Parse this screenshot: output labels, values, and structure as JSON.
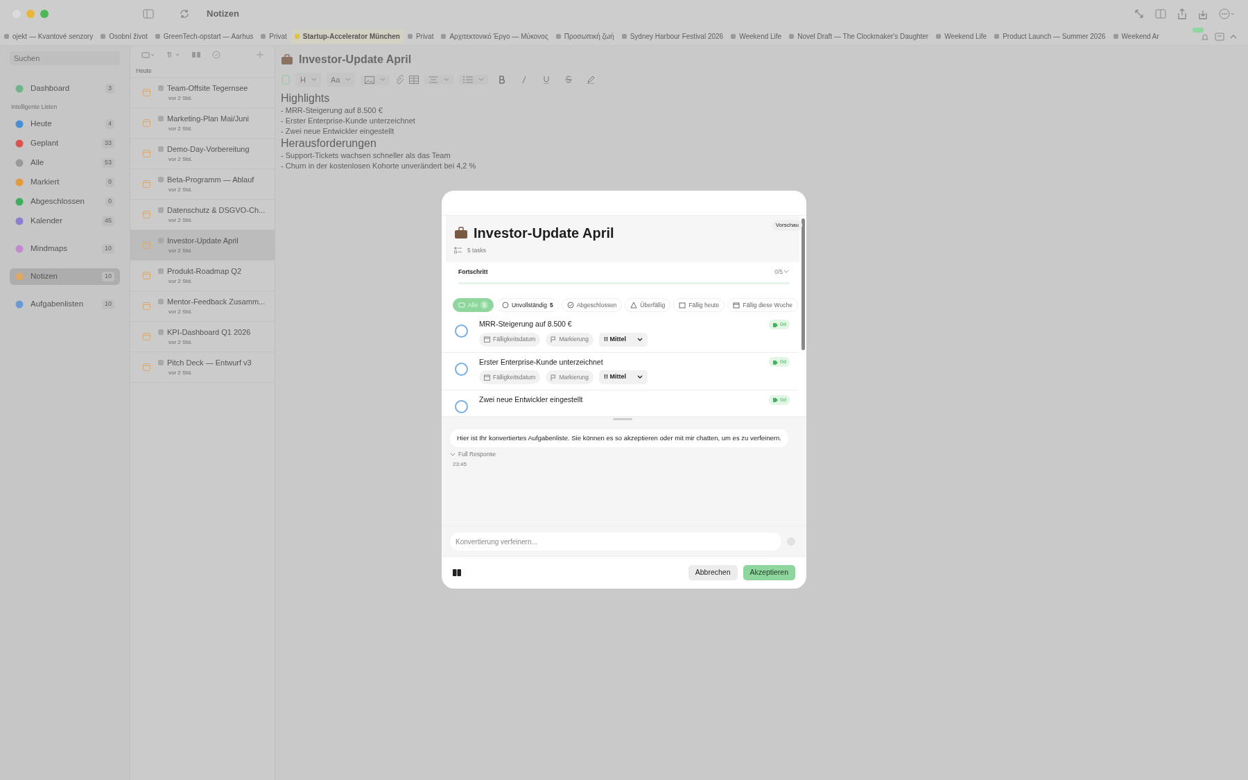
{
  "window": {
    "title": "Notizen"
  },
  "tabs": [
    {
      "label": "ojekt — Kvantové senzory",
      "selected": false
    },
    {
      "label": "Osobní život",
      "selected": false
    },
    {
      "label": "GreenTech-opstart — Aarhus",
      "selected": false
    },
    {
      "label": "Privat",
      "selected": false
    },
    {
      "label": "Startup-Accelerator München",
      "selected": true
    },
    {
      "label": "Privat",
      "selected": false
    },
    {
      "label": "Αρχιτεκτονικό Έργο — Μύκονος",
      "selected": false
    },
    {
      "label": "Προσωπική ζωή",
      "selected": false
    },
    {
      "label": "Sydney Harbour Festival 2026",
      "selected": false
    },
    {
      "label": "Weekend Life",
      "selected": false
    },
    {
      "label": "Novel Draft — The Clockmaker's Daughter",
      "selected": false
    },
    {
      "label": "Weekend Life",
      "selected": false
    },
    {
      "label": "Product Launch — Summer 2026",
      "selected": false
    },
    {
      "label": "Weekend Ar",
      "selected": false
    }
  ],
  "sidebar": {
    "search": {
      "placeholder": "Suchen"
    },
    "items": [
      {
        "kind": "item",
        "label": "Dashboard",
        "count": "3",
        "color": "#6fb58a",
        "selected": false
      },
      {
        "kind": "header",
        "label": "Intelligente Listen"
      },
      {
        "kind": "item",
        "label": "Heute",
        "count": "4",
        "color": "#4a8fd6",
        "selected": false
      },
      {
        "kind": "item",
        "label": "Geplant",
        "count": "33",
        "color": "#d9534f",
        "selected": false
      },
      {
        "kind": "item",
        "label": "Alle",
        "count": "53",
        "color": "#9a9a9a",
        "selected": false
      },
      {
        "kind": "item",
        "label": "Markiert",
        "count": "0",
        "color": "#e59a3c",
        "selected": false
      },
      {
        "kind": "item",
        "label": "Abgeschlossen",
        "count": "0",
        "color": "#3fae5a",
        "selected": false
      },
      {
        "kind": "item",
        "label": "Kalender",
        "count": "45",
        "color": "#8a7fd0",
        "selected": false
      },
      {
        "kind": "gap"
      },
      {
        "kind": "item",
        "label": "Mindmaps",
        "count": "10",
        "color": "#c48ad0",
        "selected": false
      },
      {
        "kind": "gap"
      },
      {
        "kind": "item",
        "label": "Notizen",
        "count": "10",
        "color": "#e0a860",
        "selected": true
      },
      {
        "kind": "gap"
      },
      {
        "kind": "item",
        "label": "Aufgabenlisten",
        "count": "10",
        "color": "#6a9ad6",
        "selected": false
      }
    ]
  },
  "note_list": {
    "section": "Heute",
    "notes": [
      {
        "title": "Team-Offsite Tegernsee",
        "meta": "vor 2 Std.",
        "selected": false
      },
      {
        "title": "Marketing-Plan Mai/Juni",
        "meta": "vor 2 Std.",
        "selected": false
      },
      {
        "title": "Demo-Day-Vorbereitung",
        "meta": "vor 2 Std.",
        "selected": false
      },
      {
        "title": "Beta-Programm — Ablauf",
        "meta": "vor 2 Std.",
        "selected": false
      },
      {
        "title": "Datenschutz & DSGVO-Ch...",
        "meta": "vor 2 Std.",
        "selected": false
      },
      {
        "title": "Investor-Update April",
        "meta": "vor 2 Std.",
        "selected": true
      },
      {
        "title": "Produkt-Roadmap Q2",
        "meta": "vor 2 Std.",
        "selected": false
      },
      {
        "title": "Mentor-Feedback Zusamm...",
        "meta": "vor 2 Std.",
        "selected": false
      },
      {
        "title": "KPI-Dashboard Q1 2026",
        "meta": "vor 2 Std.",
        "selected": false
      },
      {
        "title": "Pitch Deck — Entwurf v3",
        "meta": "vor 2 Std.",
        "selected": false
      }
    ]
  },
  "editor": {
    "title": "Investor-Update April",
    "toolbar": {
      "heading": "H",
      "font": "Aa"
    },
    "blocks": [
      {
        "kind": "heading",
        "text": "Highlights"
      },
      {
        "kind": "bullet",
        "text": "- MRR-Steigerung auf 8.500 €"
      },
      {
        "kind": "bullet",
        "text": "- Erster Enterprise-Kunde unterzeichnet"
      },
      {
        "kind": "bullet",
        "text": "- Zwei neue Entwickler eingestellt"
      },
      {
        "kind": "heading",
        "text": "Herausforderungen"
      },
      {
        "kind": "bullet",
        "text": "- Support-Tickets wachsen schneller als das Team"
      },
      {
        "kind": "bullet",
        "text": "- Churn in der kostenlosen Kohorte unverändert bei 4,2 %"
      }
    ]
  },
  "modal": {
    "title": "Investor-Update April",
    "task_count": "5 tasks",
    "preview": "Vorschau",
    "progress": {
      "label": "Fortschritt",
      "reading": "0/5",
      "level": 0
    },
    "filters": [
      {
        "label": "Alle",
        "count": "5",
        "selected": true
      },
      {
        "label": "Unvollständig",
        "count": "5",
        "selected": false
      },
      {
        "label": "Abgeschlossen",
        "selected": false
      },
      {
        "label": "Überfällig",
        "selected": false
      },
      {
        "label": "Fällig heute",
        "selected": false
      },
      {
        "label": "Fällig diese Woche",
        "selected": false
      }
    ],
    "tasks": [
      {
        "title": "MRR-Steigerung auf 8.500 €",
        "checked": false,
        "badge": "0d",
        "due": "Fälligkeitsdatum",
        "flag": "Markierung",
        "priority_mark": "!!",
        "priority": "Mittel"
      },
      {
        "title": "Erster Enterprise-Kunde unterzeichnet",
        "checked": false,
        "badge": "0d",
        "due": "Fälligkeitsdatum",
        "flag": "Markierung",
        "priority_mark": "!!",
        "priority": "Mittel"
      },
      {
        "title": "Zwei neue Entwickler eingestellt",
        "checked": false,
        "badge": "0d"
      }
    ],
    "message": "Hier ist Ihr konvertiertes Aufgabenliste. Sie können es so akzeptieren oder mit mir chatten, um es zu verfeinern.",
    "full_response": {
      "label": "Full Response",
      "expanded": true
    },
    "time": "23:45",
    "input": {
      "placeholder": "Konvertierung verfeinern..."
    },
    "buttons": {
      "cancel": "Abbrechen",
      "accept": "Akzeptieren"
    }
  }
}
